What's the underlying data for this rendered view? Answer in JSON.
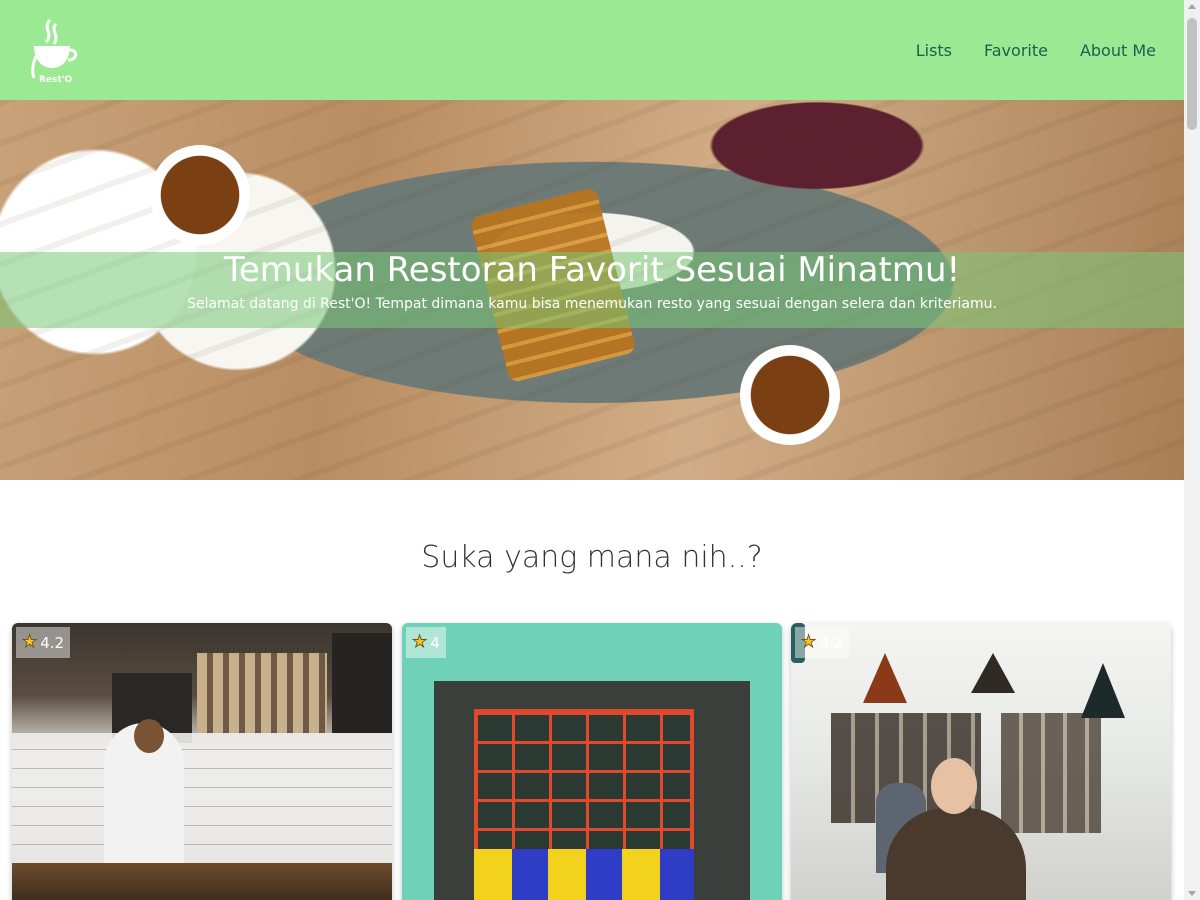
{
  "header": {
    "logo_text": "Rest'O",
    "nav": [
      {
        "label": "Lists"
      },
      {
        "label": "Favorite"
      },
      {
        "label": "About Me"
      }
    ],
    "background_color": "#9be993"
  },
  "hero": {
    "title": "Temukan Restoran Favorit Sesuai Minatmu!",
    "subtitle": "Selamat datang di Rest'O! Tempat dimana kamu bisa menemukan resto yang sesuai dengan selera dan kriteriamu."
  },
  "section": {
    "title": "Suka yang mana nih..?"
  },
  "restaurants": [
    {
      "rating": "4.2",
      "rating_icon": "star-icon"
    },
    {
      "rating": "4",
      "rating_icon": "star-icon"
    },
    {
      "rating": "4.2",
      "rating_icon": "star-icon"
    }
  ]
}
